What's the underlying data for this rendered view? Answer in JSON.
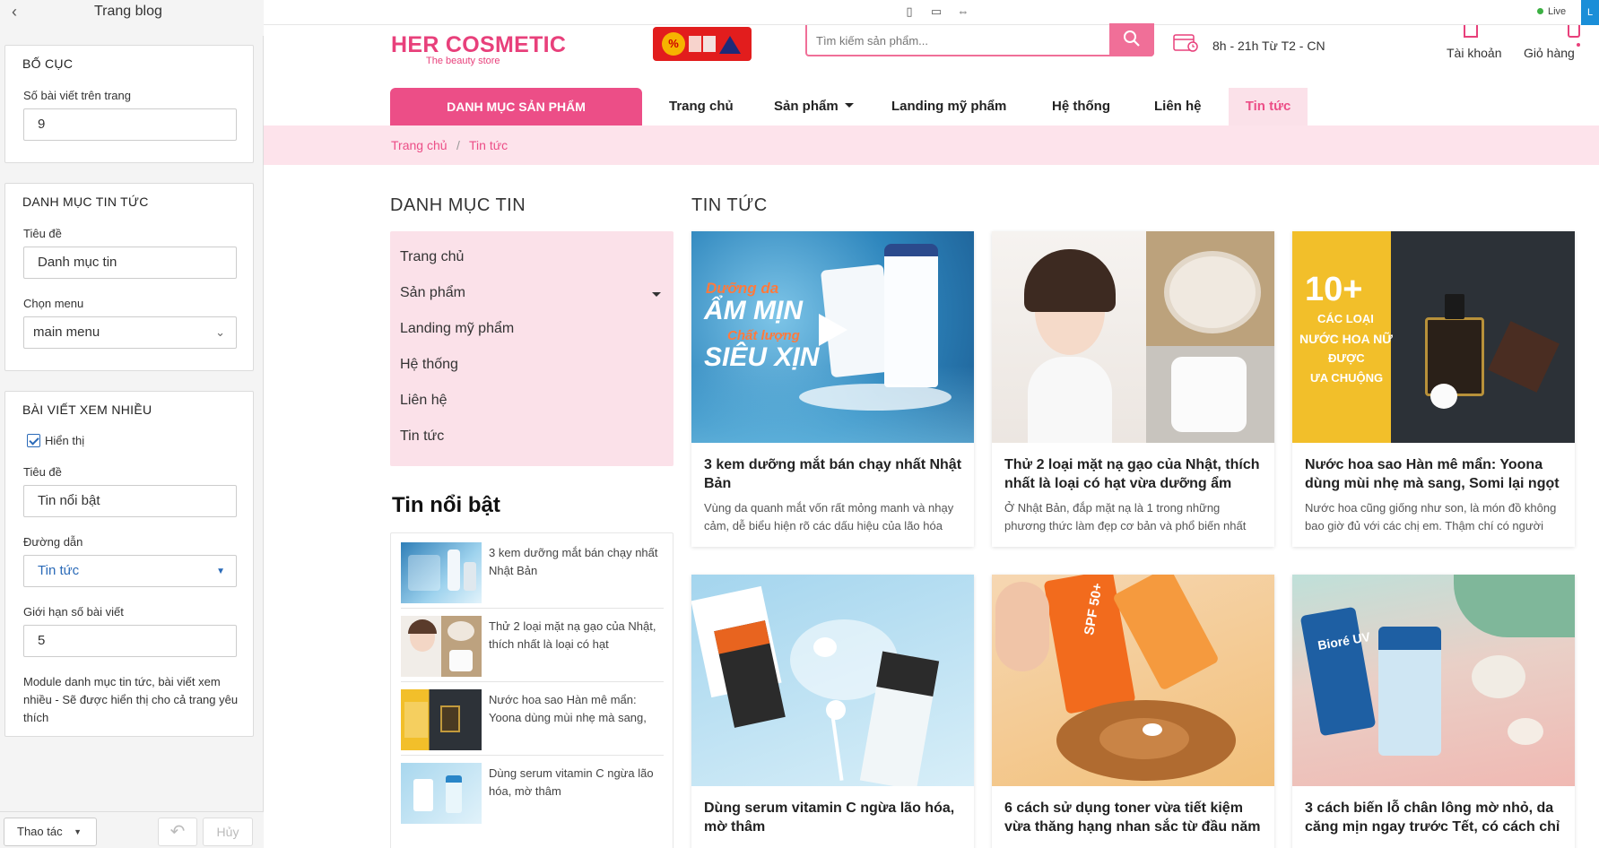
{
  "panel": {
    "title": "Trang blog",
    "layout": {
      "heading": "BỐ CỤC",
      "posts_label": "Số bài viết trên trang",
      "posts_value": "9"
    },
    "categories": {
      "heading": "DANH MỤC TIN TỨC",
      "title_label": "Tiêu đề",
      "title_value": "Danh mục tin",
      "menu_label": "Chọn menu",
      "menu_value": "main menu"
    },
    "popular": {
      "heading": "BÀI VIẾT XEM NHIỀU",
      "show_label": "Hiển thị",
      "title_label": "Tiêu đề",
      "title_value": "Tin nổi bật",
      "path_label": "Đường dẫn",
      "path_value": "Tin tức",
      "limit_label": "Giới hạn số bài viết",
      "limit_value": "5",
      "note": "Module danh mục tin tức, bài viết xem nhiều - Sẽ được hiển thị cho cả trang yêu thích"
    },
    "footer": {
      "actions": "Thao tác",
      "cancel": "Hủy"
    }
  },
  "topbar": {
    "live": "Live",
    "live_btn": "L"
  },
  "site": {
    "logo": "HER COSMETIC",
    "logo_sub": "The beauty store",
    "search_placeholder": "Tìm kiếm sản phẩm...",
    "hours": "8h - 21h Từ T2 - CN",
    "account": "Tài khoản",
    "cart": "Giỏ hàng",
    "promo_badge": "%",
    "accent": "#ec4e87",
    "nav": {
      "category_button": "DANH MỤC SẢN PHẨM",
      "items": [
        "Trang chủ",
        "Sản phẩm",
        "Landing mỹ phẩm",
        "Hệ thống",
        "Liên hệ",
        "Tin tức"
      ]
    },
    "breadcrumb": {
      "home": "Trang chủ",
      "sep": "/",
      "current": "Tin tức"
    }
  },
  "sidebar": {
    "heading": "DANH MỤC TIN",
    "links": [
      "Trang chủ",
      "Sản phẩm",
      "Landing mỹ phẩm",
      "Hệ thống",
      "Liên hệ",
      "Tin tức"
    ],
    "featured_heading": "Tin nổi bật",
    "featured": [
      "3 kem dưỡng mắt bán chạy nhất Nhật Bản",
      "Thử 2 loại mặt nạ gạo của Nhật, thích nhất là loại có hạt",
      "Nước hoa sao Hàn mê mẩn: Yoona dùng mùi nhẹ mà sang,",
      "Dùng serum vitamin C ngừa lão hóa, mờ thâm"
    ]
  },
  "news": {
    "heading": "TIN TỨC",
    "posts": [
      {
        "title": "3 kem dưỡng mắt bán chạy nhất Nhật Bản",
        "summary": "Vùng da quanh mắt vốn rất mỏng manh và nhạy cảm, dễ biểu hiện rõ các dấu hiệu của lão hóa"
      },
      {
        "title": "Thử 2 loại mặt nạ gạo của Nhật, thích nhất là loại có hạt vừa dưỡng ẩm",
        "summary": "Ở Nhật Bản, đắp mặt nạ là 1 trong những phương thức làm đẹp cơ bản và phổ biến nhất"
      },
      {
        "title": "Nước hoa sao Hàn mê mẩn: Yoona dùng mùi nhẹ mà sang, Somi lại ngọt ngào",
        "summary": "Nước hoa cũng giống như son, là món đồ không bao giờ đủ với các chị em. Thậm chí có người"
      },
      {
        "title": "Dùng serum vitamin C ngừa lão hóa, mờ thâm",
        "summary": ""
      },
      {
        "title": "6 cách sử dụng toner vừa tiết kiệm vừa thăng hạng nhan sắc từ đầu năm",
        "summary": ""
      },
      {
        "title": "3 cách biến lỗ chân lông mờ nhỏ, da căng mịn ngay trước Tết, có cách chỉ",
        "summary": ""
      }
    ],
    "img_text": {
      "p1_line1": "Dưỡng da",
      "p1_line2": "ẨM MỊN",
      "p1_line3": "Chất lượng",
      "p1_line4": "SIÊU XỊN",
      "p3_big": "10+",
      "p3_line1": "CÁC LOẠI",
      "p3_line2": "NƯỚC HOA NỮ",
      "p3_line3": "ĐƯỢC",
      "p3_line4": "ƯA CHUỘNG",
      "p5_spf": "SPF 50+",
      "p6_brand": "Bioré UV"
    }
  }
}
